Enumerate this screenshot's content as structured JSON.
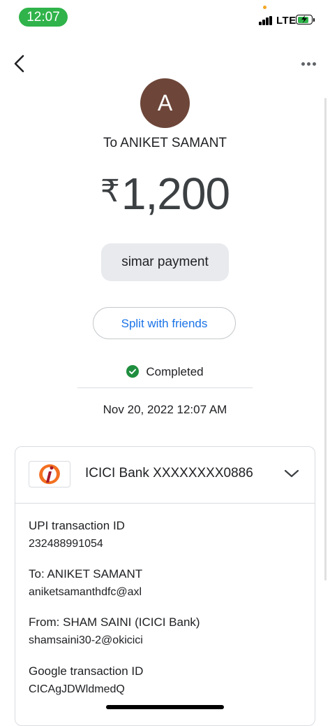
{
  "status_bar": {
    "time": "12:07",
    "network": "LTE"
  },
  "header": {
    "back_icon": "chevron-left-icon",
    "more_icon": "more-horiz-icon"
  },
  "recipient": {
    "avatar_letter": "A",
    "to_label": "To ANIKET SAMANT"
  },
  "payment": {
    "currency": "₹",
    "amount": "1,200",
    "note": "simar payment"
  },
  "actions": {
    "split_label": "Split with friends"
  },
  "status": {
    "label": "Completed",
    "color": "#1e8e3e",
    "datetime": "Nov 20, 2022 12:07 AM"
  },
  "bank": {
    "name": "ICICI Bank XXXXXXXX0886",
    "logo_icon": "icici-logo-icon"
  },
  "details": [
    {
      "label": "UPI transaction ID",
      "value": "232488991054"
    },
    {
      "label": "To: ANIKET SAMANT",
      "value": "aniketsamanthdfc@axl"
    },
    {
      "label": "From: SHAM SAINI (ICICI Bank)",
      "value": "shamsaini30-2@okicici"
    },
    {
      "label": "Google transaction ID",
      "value": "CICAgJDWldmedQ"
    }
  ],
  "colors": {
    "accent": "#1a73e8",
    "avatar_bg": "#6d4639",
    "status_green": "#2fb34a"
  }
}
